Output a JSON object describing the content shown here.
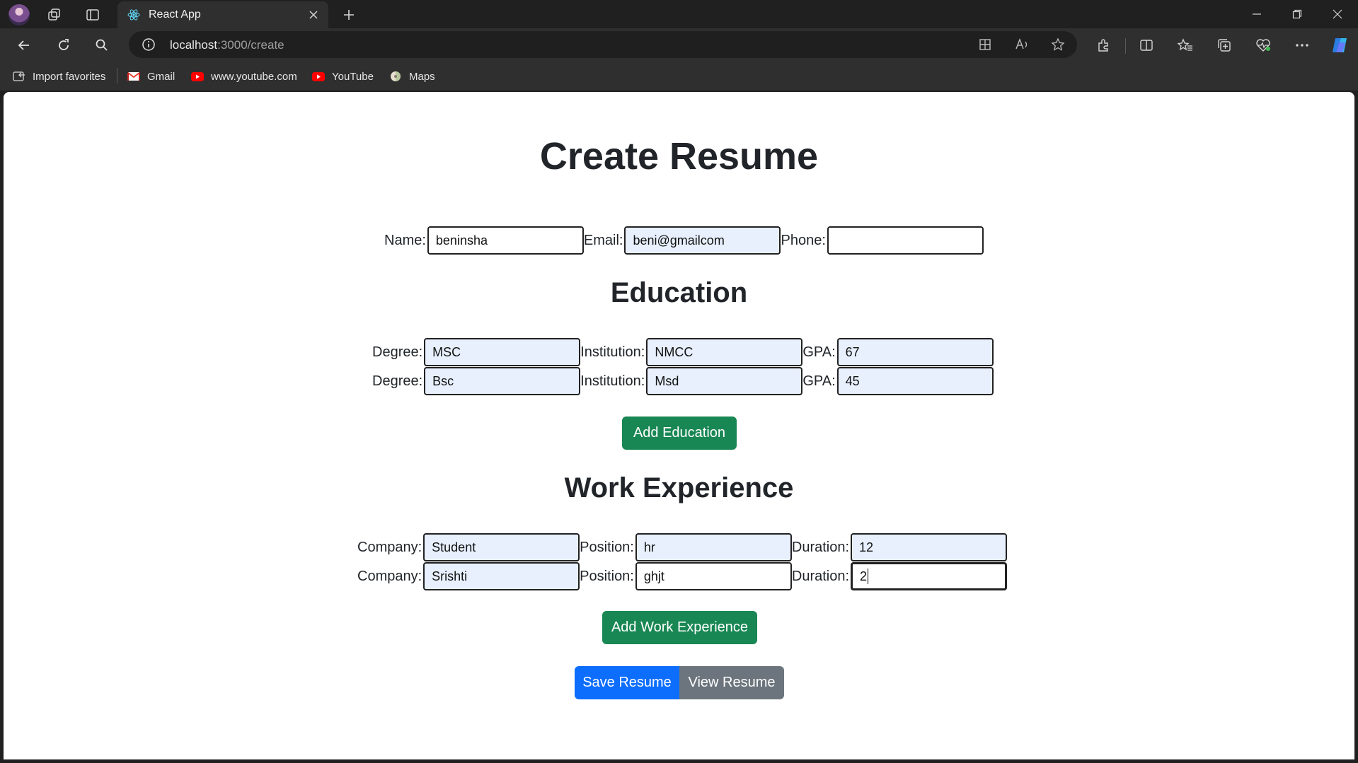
{
  "browser": {
    "tab_title": "React App",
    "url_host": "localhost",
    "url_path": ":3000/create",
    "bookmarks": [
      {
        "label": "Import favorites",
        "icon": "import-icon"
      },
      {
        "label": "Gmail",
        "icon": "gmail-icon"
      },
      {
        "label": "www.youtube.com",
        "icon": "youtube-icon"
      },
      {
        "label": "YouTube",
        "icon": "youtube-icon"
      },
      {
        "label": "Maps",
        "icon": "maps-icon"
      }
    ]
  },
  "page": {
    "title": "Create Resume",
    "personal": {
      "name_label": "Name:",
      "name_value": "beninsha",
      "email_label": "Email:",
      "email_value": "beni@gmailcom",
      "phone_label": "Phone:",
      "phone_value": ""
    },
    "education": {
      "heading": "Education",
      "degree_label": "Degree:",
      "institution_label": "Institution:",
      "gpa_label": "GPA:",
      "rows": [
        {
          "degree": "MSC",
          "institution": "NMCC",
          "gpa": "67"
        },
        {
          "degree": "Bsc",
          "institution": "Msd",
          "gpa": "45"
        }
      ],
      "add_button": "Add Education"
    },
    "work": {
      "heading": "Work Experience",
      "company_label": "Company:",
      "position_label": "Position:",
      "duration_label": "Duration:",
      "rows": [
        {
          "company": "Student",
          "position": "hr",
          "duration": "12"
        },
        {
          "company": "Srishti",
          "position": "ghjt",
          "duration": "2"
        }
      ],
      "add_button": "Add Work Experience"
    },
    "save_button": "Save Resume",
    "view_button": "View Resume"
  },
  "colors": {
    "primary": "#0d6efd",
    "success": "#198754",
    "secondary": "#6c757d",
    "autofill": "#e8f0fe"
  }
}
